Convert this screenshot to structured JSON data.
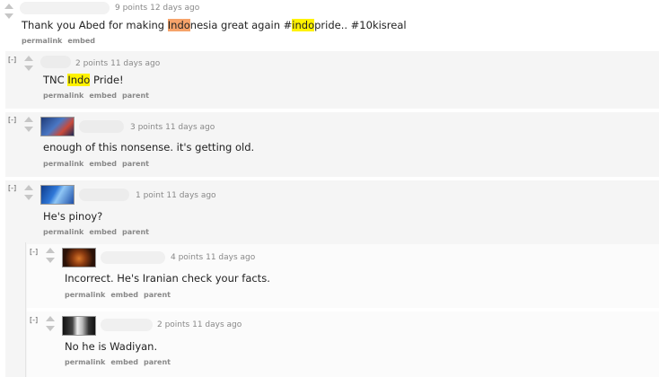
{
  "comments": [
    {
      "meta": "9 points 12 days ago",
      "body_parts": [
        "Thank you Abed for making ",
        "Indo",
        "nesia great again #",
        "indo",
        "pride.. #10kisreal"
      ],
      "links": [
        "permalink",
        "embed"
      ]
    },
    {
      "toggle": "[-]",
      "meta": "2 points 11 days ago",
      "body_parts": [
        "TNC ",
        "Indo",
        " Pride!"
      ],
      "links": [
        "permalink",
        "embed",
        "parent"
      ]
    },
    {
      "toggle": "[-]",
      "meta": "3 points 11 days ago",
      "body": "enough of this nonsense. it's getting old.",
      "links": [
        "permalink",
        "embed",
        "parent"
      ]
    },
    {
      "toggle": "[-]",
      "meta": "1 point 11 days ago",
      "body": "He's pinoy?",
      "links": [
        "permalink",
        "embed",
        "parent"
      ]
    },
    {
      "toggle": "[-]",
      "meta": "4 points 11 days ago",
      "body": "Incorrect. He's Iranian check your facts.",
      "links": [
        "permalink",
        "embed",
        "parent"
      ]
    },
    {
      "toggle": "[-]",
      "meta": "2 points 11 days ago",
      "body": "No he is Wadiyan.",
      "links": [
        "permalink",
        "embed",
        "parent"
      ]
    }
  ],
  "colors": {
    "panel": "#f5f5f5",
    "highlight_orange": "#f6a36a",
    "highlight_yellow": "#fff200",
    "meta": "#888888"
  },
  "icons": {
    "upvote": "arrow-up-icon",
    "downvote": "arrow-down-icon"
  }
}
